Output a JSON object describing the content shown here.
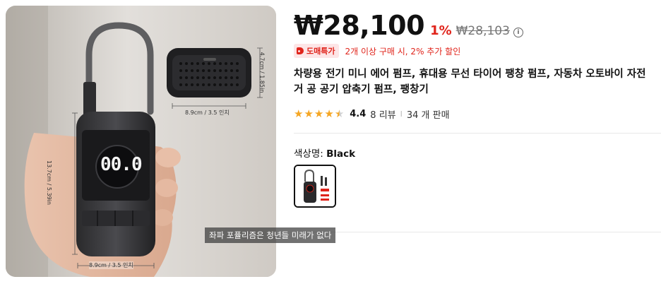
{
  "product": {
    "price": "₩28,100",
    "discount": "1%",
    "original_price": "₩28,103",
    "info_icon": "i",
    "badge_label": "도매특가",
    "promo_text": "2개 이상 구매 시, 2% 추가 할인",
    "title": "차량용 전기 미니 에어 펌프, 휴대용 무선 타이어 팽창 펌프, 자동차 오토바이 자전거 공 공기 압축기 펌프, 팽창기",
    "rating": "4.4",
    "rating_value": 4.4,
    "review_count": "8 리뷰",
    "separator": "I",
    "sold_count": "34 개 판매",
    "color_label_prefix": "색상명: ",
    "color_value": "Black"
  },
  "photo": {
    "display_digits": "00.0",
    "height_dim": "13.7cm / 5.39in",
    "width_dim": "8.9cm / 3.5 인치",
    "width_dim_bottom": "8.9cm / 3.5 인치",
    "side_height": "4.7cm / 1.85in"
  },
  "overlay": {
    "subtitle": "좌파 포퓰리즘은 청년들 미래가 없다"
  },
  "colors": {
    "accent_red": "#e0241b",
    "star": "#f5a623",
    "badge_bg": "#fde5e6"
  }
}
